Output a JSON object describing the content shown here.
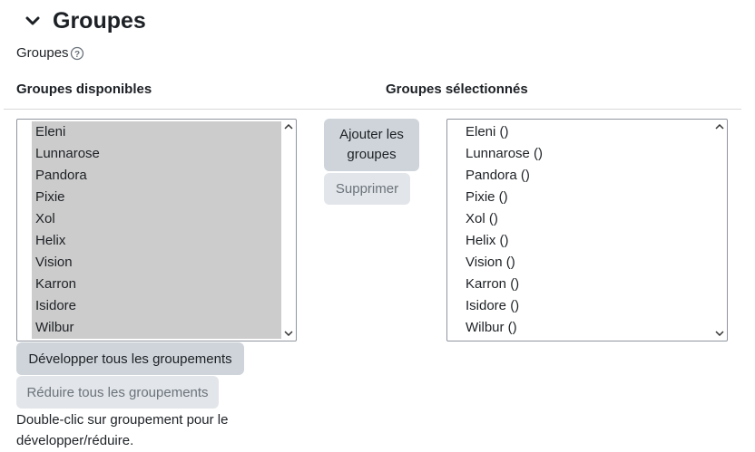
{
  "section": {
    "title": "Groupes"
  },
  "field": {
    "label": "Groupes"
  },
  "available": {
    "heading": "Groupes disponibles",
    "items": [
      "Eleni",
      "Lunnarose",
      "Pandora",
      "Pixie",
      "Xol",
      "Helix",
      "Vision",
      "Karron",
      "Isidore",
      "Wilbur"
    ]
  },
  "selected": {
    "heading": "Groupes sélectionnés",
    "items": [
      "Eleni ()",
      "Lunnarose ()",
      "Pandora ()",
      "Pixie ()",
      "Xol ()",
      "Helix ()",
      "Vision ()",
      "Karron ()",
      "Isidore ()",
      "Wilbur ()"
    ]
  },
  "buttons": {
    "add": "Ajouter les groupes",
    "remove": "Supprimer",
    "expand_all": "Développer tous les groupements",
    "collapse_all": "Réduire tous les groupements"
  },
  "hint": "Double-clic sur groupement pour le développer/réduire.",
  "colors": {
    "selected_bg": "#cccccc",
    "button_bg": "#ced4da",
    "button_disabled_bg": "#e2e5e9"
  }
}
